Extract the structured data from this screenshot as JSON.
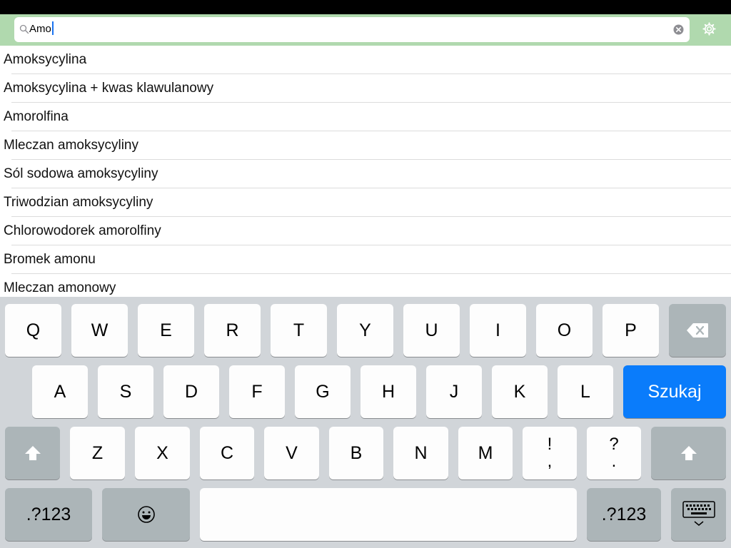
{
  "search": {
    "value": "Amo"
  },
  "results": [
    "Amoksycylina",
    "Amoksycylina + kwas klawulanowy",
    "Amorolfina",
    "Mleczan amoksycyliny",
    "Sól sodowa amoksycyliny",
    "Triwodzian amoksycyliny",
    "Chlorowodorek amorolfiny",
    "Bromek amonu",
    "Mleczan amonowy"
  ],
  "keyboard": {
    "row1": [
      "Q",
      "W",
      "E",
      "R",
      "T",
      "Y",
      "U",
      "I",
      "O",
      "P"
    ],
    "row2": [
      "A",
      "S",
      "D",
      "F",
      "G",
      "H",
      "J",
      "K",
      "L"
    ],
    "row3": [
      "Z",
      "X",
      "C",
      "V",
      "B",
      "N",
      "M"
    ],
    "punct1": {
      "top": "!",
      "bottom": ","
    },
    "punct2": {
      "top": "?",
      "bottom": "."
    },
    "search_label": "Szukaj",
    "numbers_label": ".?123",
    "icons": {
      "backspace": "backspace-icon",
      "shift": "shift-icon",
      "emoji": "emoji-icon",
      "hide_keyboard": "keyboard-dismiss-icon"
    }
  },
  "colors": {
    "search_bar": "#b0d9ae",
    "search_key": "#0a7cfb"
  }
}
